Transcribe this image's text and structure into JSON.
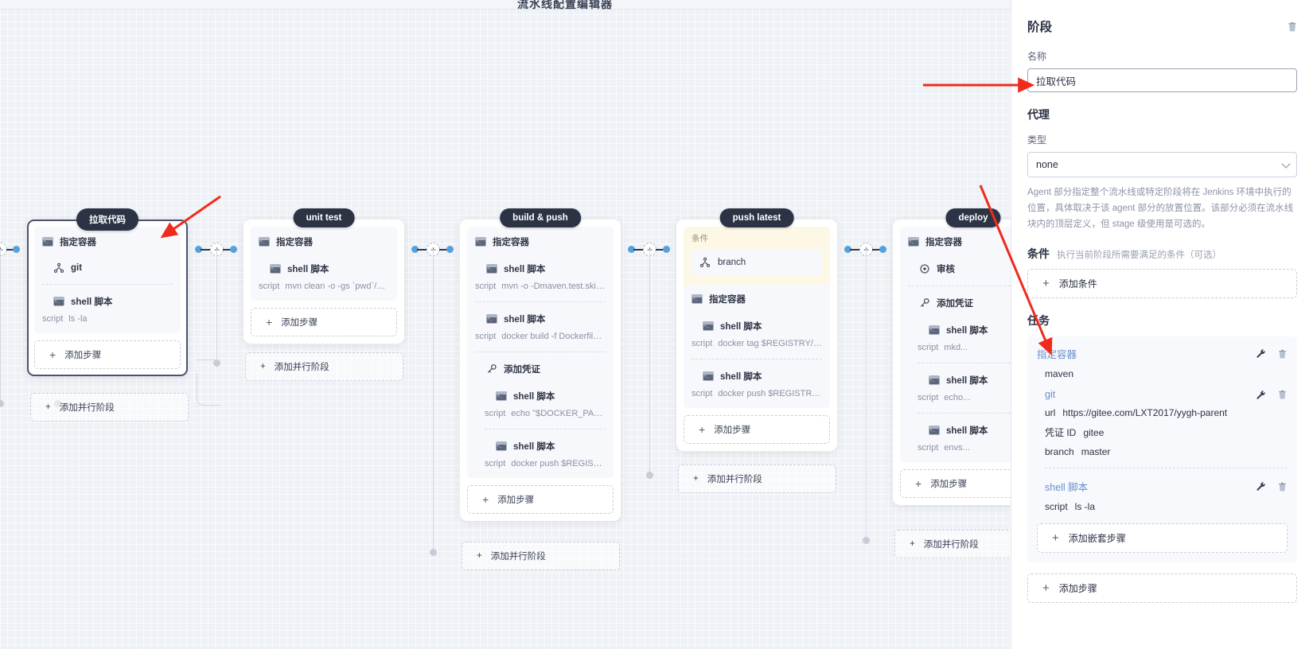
{
  "canvas": {
    "top_title": "流水线配置编辑器",
    "zoom_in": "+",
    "zoom_out": "−"
  },
  "stages": [
    {
      "badge": "拉取代码",
      "selected": true,
      "steps": [
        {
          "icon": "terminal-icon",
          "title": "指定容器",
          "indent": 0
        },
        {
          "icon": "git-icon",
          "title": "git",
          "indent": 1
        },
        {
          "sep": true
        },
        {
          "icon": "terminal-icon",
          "title": "shell 脚本",
          "indent": 1,
          "key": "script",
          "value": "ls -la"
        }
      ],
      "add_step": "添加步骤",
      "add_parallel": "添加并行阶段"
    },
    {
      "badge": "unit test",
      "selected": false,
      "steps": [
        {
          "icon": "terminal-icon",
          "title": "指定容器",
          "indent": 0
        },
        {
          "icon": "terminal-icon",
          "title": "shell 脚本",
          "indent": 1,
          "key": "script",
          "value": "mvn clean -o -gs `pwd`/con..."
        }
      ],
      "add_step": "添加步骤",
      "add_parallel": "添加并行阶段"
    },
    {
      "badge": "build & push",
      "selected": false,
      "steps": [
        {
          "icon": "terminal-icon",
          "title": "指定容器",
          "indent": 0
        },
        {
          "icon": "terminal-icon",
          "title": "shell 脚本",
          "indent": 1,
          "key": "script",
          "value": "mvn -o -Dmaven.test.skip=t..."
        },
        {
          "sep": true
        },
        {
          "icon": "terminal-icon",
          "title": "shell 脚本",
          "indent": 1,
          "key": "script",
          "value": "docker build -f Dockerfile-o..."
        },
        {
          "sep": true
        },
        {
          "icon": "key-icon",
          "title": "添加凭证",
          "indent": 1
        },
        {
          "icon": "terminal-icon",
          "title": "shell 脚本",
          "indent": 2,
          "key": "script",
          "value": "echo \"$DOCKER_PASS..."
        },
        {
          "sep": true
        },
        {
          "icon": "terminal-icon",
          "title": "shell 脚本",
          "indent": 2,
          "key": "script",
          "value": "docker push $REGISTR..."
        }
      ],
      "add_step": "添加步骤",
      "add_parallel": "添加并行阶段"
    },
    {
      "badge": "push latest",
      "selected": false,
      "condition_label": "条件",
      "condition_item": "branch",
      "steps": [
        {
          "icon": "terminal-icon",
          "title": "指定容器",
          "indent": 0
        },
        {
          "icon": "terminal-icon",
          "title": "shell 脚本",
          "indent": 1,
          "key": "script",
          "value": "docker tag $REGISTRY/$D..."
        },
        {
          "sep": true
        },
        {
          "icon": "terminal-icon",
          "title": "shell 脚本",
          "indent": 1,
          "key": "script",
          "value": "docker push $REGISTRY/$..."
        }
      ],
      "add_step": "添加步骤",
      "add_parallel": "添加并行阶段"
    },
    {
      "badge": "deploy",
      "selected": false,
      "steps": [
        {
          "icon": "terminal-icon",
          "title": "指定容器",
          "indent": 0
        },
        {
          "icon": "check-icon",
          "title": "审核",
          "indent": 1
        },
        {
          "sep": true
        },
        {
          "icon": "key-icon",
          "title": "添加凭证",
          "indent": 1
        },
        {
          "icon": "terminal-icon",
          "title": "shell 脚本",
          "indent": 2,
          "key": "script",
          "value": "mkd..."
        },
        {
          "sep": true
        },
        {
          "icon": "terminal-icon",
          "title": "shell 脚本",
          "indent": 2,
          "key": "script",
          "value": "echo..."
        },
        {
          "sep": true
        },
        {
          "icon": "terminal-icon",
          "title": "shell 脚本",
          "indent": 2,
          "key": "script",
          "value": "envs..."
        }
      ],
      "add_step": "添加步骤",
      "add_parallel": "添加并行阶段"
    }
  ],
  "panel": {
    "title": "阶段",
    "delete_icon": "trash-icon",
    "name_label": "名称",
    "name_value": "拉取代码",
    "agent_title": "代理",
    "type_label": "类型",
    "type_value": "none",
    "agent_help": "Agent 部分指定整个流水线或特定阶段将在 Jenkins 环境中执行的位置，具体取决于该 agent 部分的放置位置。该部分必须在流水线块内的顶层定义，但 stage 级使用是可选的。",
    "condition_title": "条件",
    "condition_hint": "执行当前阶段所需要满足的条件（可选）",
    "add_condition": "添加条件",
    "tasks_title": "任务",
    "tasks": [
      {
        "name": "指定容器",
        "value_line": "maven",
        "children": [
          {
            "name": "git",
            "kvs": [
              {
                "k": "url",
                "v": "https://gitee.com/LXT2017/yygh-parent"
              },
              {
                "k": "凭证 ID",
                "v": "gitee"
              },
              {
                "k": "branch",
                "v": "master"
              }
            ]
          },
          {
            "name": "shell 脚本",
            "kvs": [
              {
                "k": "script",
                "v": "ls -la"
              }
            ]
          }
        ],
        "add_nested": "添加嵌套步骤"
      }
    ],
    "add_step": "添加步骤",
    "edit_icon": "wrench-icon"
  },
  "colors": {
    "accent": "#56a0dd",
    "badge_bg": "#2c3345",
    "link": "#6a8fd0",
    "annotation": "#f02b1d"
  }
}
